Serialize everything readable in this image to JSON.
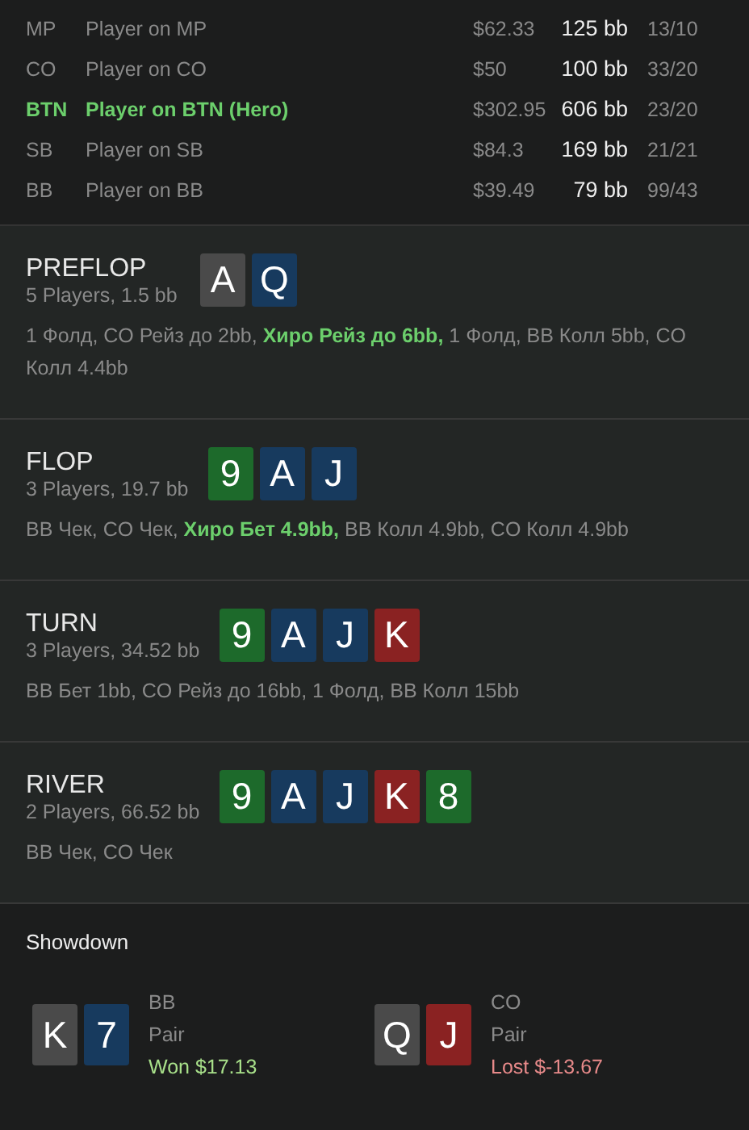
{
  "players": [
    {
      "position": "MP",
      "name": "Player on MP",
      "stack": "$62.33",
      "stack_bb": "125 bb",
      "stats": "13/10",
      "hero": false
    },
    {
      "position": "CO",
      "name": "Player on CO",
      "stack": "$50",
      "stack_bb": "100 bb",
      "stats": "33/20",
      "hero": false
    },
    {
      "position": "BTN",
      "name": "Player on BTN (Hero)",
      "stack": "$302.95",
      "stack_bb": "606 bb",
      "stats": "23/20",
      "hero": true
    },
    {
      "position": "SB",
      "name": "Player on SB",
      "stack": "$84.3",
      "stack_bb": "169 bb",
      "stats": "21/21",
      "hero": false
    },
    {
      "position": "BB",
      "name": "Player on BB",
      "stack": "$39.49",
      "stack_bb": "79 bb",
      "stats": "99/43",
      "hero": false
    }
  ],
  "streets": [
    {
      "name": "PREFLOP",
      "info": "5 Players, 1.5 bb",
      "cards": [
        {
          "rank": "A",
          "color": "#4a4a4a"
        },
        {
          "rank": "Q",
          "color": "#173a5e"
        }
      ],
      "actions": [
        {
          "text": "1 Фолд, CO Рейз до 2bb, ",
          "hero": false
        },
        {
          "text": "Хиро Рейз до 6bb,",
          "hero": true
        },
        {
          "text": " 1 Фолд, BB Колл 5bb, CO Колл 4.4bb",
          "hero": false
        }
      ]
    },
    {
      "name": "FLOP",
      "info": "3 Players, 19.7 bb",
      "cards": [
        {
          "rank": "9",
          "color": "#1d6a2b"
        },
        {
          "rank": "A",
          "color": "#173a5e"
        },
        {
          "rank": "J",
          "color": "#173a5e"
        }
      ],
      "actions": [
        {
          "text": "BB Чек, CO Чек, ",
          "hero": false
        },
        {
          "text": "Хиро Бет 4.9bb,",
          "hero": true
        },
        {
          "text": " BB Колл 4.9bb, CO Колл 4.9bb",
          "hero": false
        }
      ]
    },
    {
      "name": "TURN",
      "info": "3 Players, 34.52 bb",
      "cards": [
        {
          "rank": "9",
          "color": "#1d6a2b"
        },
        {
          "rank": "A",
          "color": "#173a5e"
        },
        {
          "rank": "J",
          "color": "#173a5e"
        },
        {
          "rank": "K",
          "color": "#8a2222"
        }
      ],
      "actions": [
        {
          "text": "BB Бет 1bb, CO Рейз до 16bb, 1 Фолд, BB Колл 15bb",
          "hero": false
        }
      ]
    },
    {
      "name": "RIVER",
      "info": "2 Players, 66.52 bb",
      "cards": [
        {
          "rank": "9",
          "color": "#1d6a2b"
        },
        {
          "rank": "A",
          "color": "#173a5e"
        },
        {
          "rank": "J",
          "color": "#173a5e"
        },
        {
          "rank": "K",
          "color": "#8a2222"
        },
        {
          "rank": "8",
          "color": "#1d6a2b"
        }
      ],
      "actions": [
        {
          "text": "BB Чек, CO Чек",
          "hero": false
        }
      ]
    }
  ],
  "showdown": {
    "title": "Showdown",
    "hands": [
      {
        "position": "BB",
        "cards": [
          {
            "rank": "K",
            "color": "#4a4a4a"
          },
          {
            "rank": "7",
            "color": "#173a5e"
          }
        ],
        "hand": "Pair",
        "result": "Won $17.13",
        "won": true
      },
      {
        "position": "CO",
        "cards": [
          {
            "rank": "Q",
            "color": "#4a4a4a"
          },
          {
            "rank": "J",
            "color": "#8a2222"
          }
        ],
        "hand": "Pair",
        "result": "Lost $-13.67",
        "won": false
      }
    ]
  }
}
